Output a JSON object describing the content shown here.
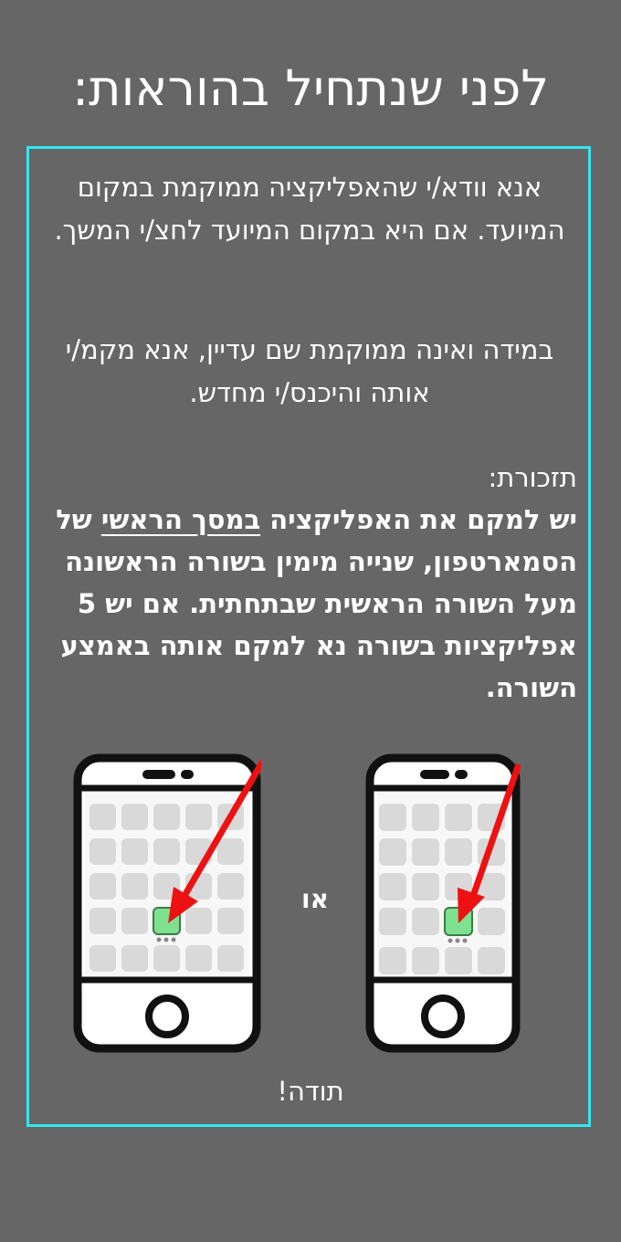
{
  "page": {
    "title": "לפני שנתחיל בהוראות:",
    "paragraph1": "אנא וודא/י שהאפליקציה ממוקמת במקום המיועד. אם היא במקום המיועד לחצ/י המשך.",
    "paragraph2": "במידה ואינה ממוקמת שם עדיין, אנא מקמ/י אותה והיכנס/י מחדש.",
    "reminder": {
      "heading": "תזכורת:",
      "text_before": "יש למקם את האפליקציה ",
      "underlined": "במסך הראשי",
      "text_after": " של הסמארטפון, שנייה מימין בשורה הראשונה מעל השורה הראשית שבתחתית. אם יש 5 אפליקציות בשורה נא למקם אותה באמצע השורה."
    },
    "or_label": "או",
    "thanks": "תודה!"
  },
  "colors": {
    "background": "#666666",
    "frame_border": "#33e5f0",
    "arrow": "#ee1111",
    "app_highlight": "#7fe090",
    "app_tile": "#d9d9d9"
  },
  "illustration": {
    "left_phone": {
      "grid": "5 columns",
      "highlighted_app": "middle of row"
    },
    "right_phone": {
      "grid": "4 columns",
      "highlighted_app": "second from right"
    }
  }
}
